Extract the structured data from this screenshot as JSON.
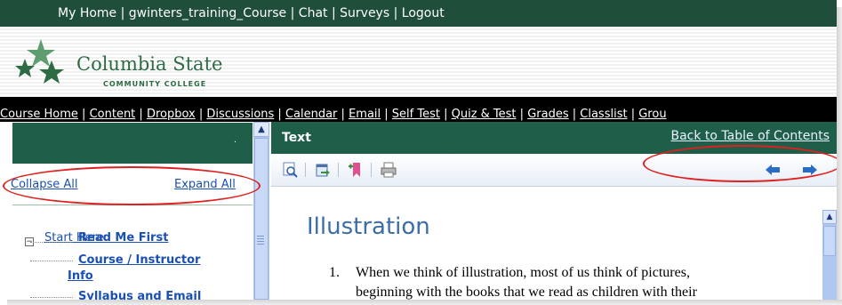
{
  "top_nav": {
    "items": [
      "My Home",
      "gwinters_training_Course",
      "Chat",
      "Surveys",
      "Logout"
    ]
  },
  "logo": {
    "name": "Columbia State",
    "sub": "COMMUNITY COLLEGE"
  },
  "course_nav": {
    "items": [
      "Course Home",
      "Content",
      "Dropbox",
      "Discussions",
      "Calendar",
      "Email",
      "Self Test",
      "Quiz & Test",
      "Grades",
      "Classlist",
      "Grou"
    ]
  },
  "left_panel": {
    "collapse_all": "Collapse All",
    "expand_all": "Expand All",
    "tree": {
      "root": "Start Here",
      "children": [
        "Read Me First",
        "Course / Instructor",
        "Info",
        "Syllabus and Email"
      ]
    }
  },
  "content": {
    "panel_title": "Text",
    "back_link": "Back to Table of Contents",
    "heading": "Illustration",
    "item_number": "1.",
    "paragraph_line1": "When we think of illustration, most of us think of pictures,",
    "paragraph_line2": "beginning with the books that we read as children with their"
  },
  "toolbar_icons": [
    "magnify-icon",
    "export-icon",
    "bookmark-icon",
    "print-icon",
    "previous-arrow-icon",
    "next-arrow-icon"
  ],
  "colors": {
    "header_green": "#1f5f49",
    "top_bar": "#1f4e3a",
    "link_blue": "#1a4fb4",
    "heading_blue": "#3b6ea8",
    "annotation_red": "#e02020"
  }
}
